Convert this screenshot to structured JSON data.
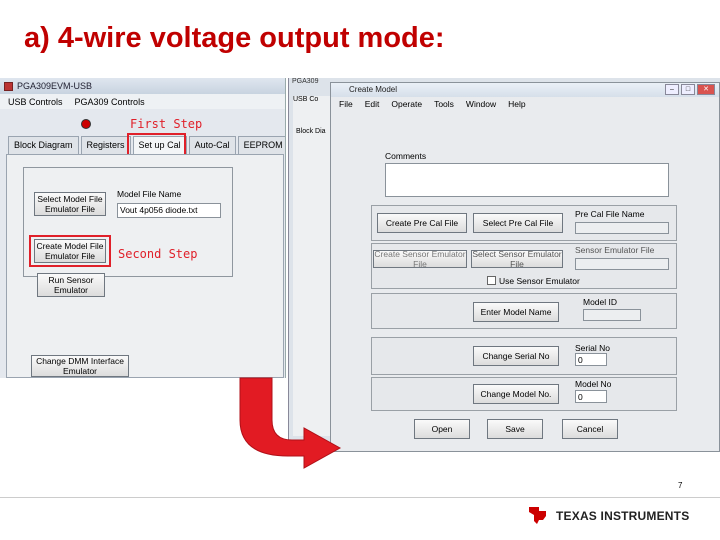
{
  "slide": {
    "title": "a) 4-wire voltage output mode:",
    "page_number": "7"
  },
  "left_window": {
    "title": "PGA309EVM-USB",
    "menu": [
      "USB Controls",
      "PGA309 Controls"
    ],
    "tabs": [
      "Block Diagram",
      "Registers",
      "Set up Cal",
      "Auto-Cal",
      "EEPROM"
    ],
    "select_model_button": "Select Model File Emulator File",
    "model_file_label": "Model File Name",
    "model_file_value": "Vout 4p056 diode.txt",
    "create_model_button": "Create Model File Emulator File",
    "run_sensor_button": "Run Sensor Emulator",
    "change_dmm_button": "Change DMM Interface Emulator",
    "first_step": "First Step",
    "second_step": "Second Step"
  },
  "right_window": {
    "bg_title": "PGA309",
    "bg_menu": "USB Co",
    "bg_tab": "Block Dia",
    "title": "Create Model",
    "menu": [
      "File",
      "Edit",
      "Operate",
      "Tools",
      "Window",
      "Help"
    ],
    "comments_label": "Comments",
    "create_pre_cal_button": "Create Pre Cal File",
    "select_pre_cal_button": "Select Pre Cal File",
    "pre_cal_label": "Pre Cal File Name",
    "create_sensor_button": "Create Sensor Emulator File",
    "select_sensor_button": "Select Sensor Emulator File",
    "sensor_label": "Sensor Emulator File",
    "use_sensor_label": "Use Sensor Emulator",
    "model_id_label": "Model ID",
    "enter_model_button": "Enter Model Name",
    "serial_label": "Serial No",
    "serial_value": "0",
    "change_serial_button": "Change Serial No",
    "model_no_label": "Model No",
    "model_no_value": "0",
    "change_model_button": "Change Model No.",
    "open_button": "Open",
    "save_button": "Save",
    "cancel_button": "Cancel"
  },
  "footer": {
    "brand": "TEXAS INSTRUMENTS"
  },
  "colors": {
    "title": "#c00000",
    "highlight": "#e0202a",
    "arrow": "#e21b23"
  }
}
